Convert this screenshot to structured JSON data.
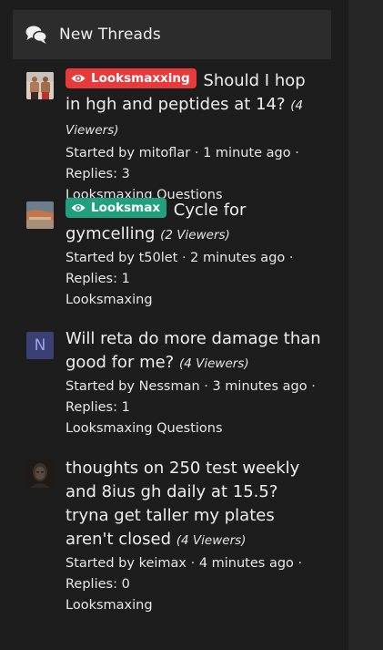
{
  "widget": {
    "title": "New Threads",
    "icon": "comments-icon"
  },
  "colors": {
    "label_red": "#e83a3a",
    "label_green": "#20a07f",
    "avatar_letter_bg": "#3b3f73"
  },
  "threads": [
    {
      "avatar": "photo",
      "label": "Looksmaxxing",
      "label_color": "red",
      "title": "Should I hop in hgh and peptides at 14?",
      "viewers": "(4 Viewers)",
      "started_prefix": "Started by",
      "author": "mitoflar",
      "time": "1 minute ago",
      "replies": "Replies: 3",
      "forum": "Looksmaxing Questions"
    },
    {
      "avatar": "photo",
      "label": "Looksmax",
      "label_color": "green",
      "title": "Cycle for gymcelling",
      "viewers": "(2 Viewers)",
      "started_prefix": "Started by",
      "author": "t50let",
      "time": "2 minutes ago",
      "replies": "Replies: 1",
      "forum": "Looksmaxing"
    },
    {
      "avatar": "N",
      "title": "Will reta do more damage than good for me?",
      "viewers": "(4 Viewers)",
      "started_prefix": "Started by",
      "author": "Nessman",
      "time": "3 minutes ago",
      "replies": "Replies: 1",
      "forum": "Looksmaxing Questions"
    },
    {
      "avatar": "photo",
      "title": "thoughts on 250 test weekly and 8ius gh daily at 15.5? tryna get taller my plates aren't closed",
      "viewers": "(4 Viewers)",
      "started_prefix": "Started by",
      "author": "keimax",
      "time": "4 minutes ago",
      "replies": "Replies: 0",
      "forum": "Looksmaxing"
    }
  ]
}
